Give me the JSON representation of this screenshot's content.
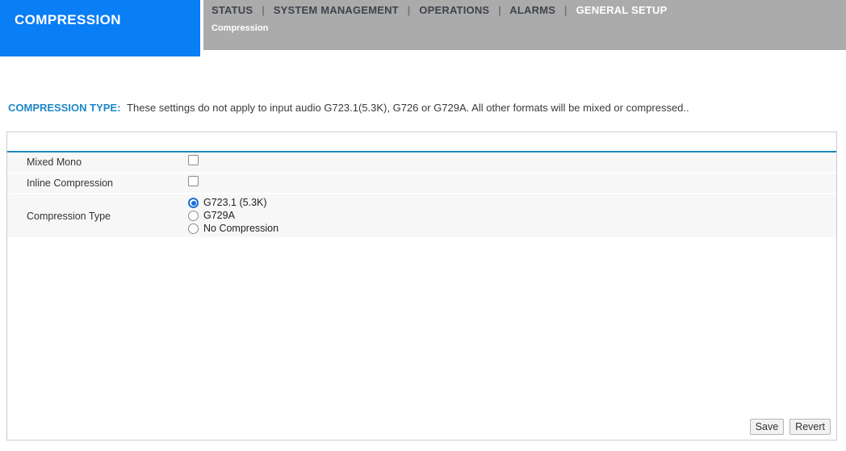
{
  "header": {
    "title": "COMPRESSION",
    "nav": {
      "separator": "|",
      "items": [
        {
          "label": "STATUS",
          "active": false
        },
        {
          "label": "SYSTEM MANAGEMENT",
          "active": false
        },
        {
          "label": "OPERATIONS",
          "active": false
        },
        {
          "label": "ALARMS",
          "active": false
        },
        {
          "label": "GENERAL SETUP",
          "active": true
        }
      ],
      "subtab": "Compression"
    }
  },
  "content": {
    "section_label": "COMPRESSION TYPE:",
    "section_description": "These settings do not apply to input audio G723.1(5.3K), G726 or G729A. All other formats will be mixed or compressed..",
    "form": {
      "rows": [
        {
          "label": "Mixed Mono",
          "type": "checkbox",
          "checked": false
        },
        {
          "label": "Inline Compression",
          "type": "checkbox",
          "checked": false
        },
        {
          "label": "Compression Type",
          "type": "radio-group",
          "options": [
            {
              "label": "G723.1 (5.3K)",
              "selected": true
            },
            {
              "label": "G729A",
              "selected": false
            },
            {
              "label": "No Compression",
              "selected": false
            }
          ]
        }
      ]
    },
    "buttons": {
      "save": "Save",
      "revert": "Revert"
    }
  },
  "colors": {
    "brand_blue": "#0a7ef5",
    "nav_gray": "#ababab",
    "section_label_blue": "#1e87c8",
    "panel_rule_blue": "#1e87b9",
    "radio_accent_blue": "#1b6fd5",
    "row_background": "#f7f7f8"
  }
}
